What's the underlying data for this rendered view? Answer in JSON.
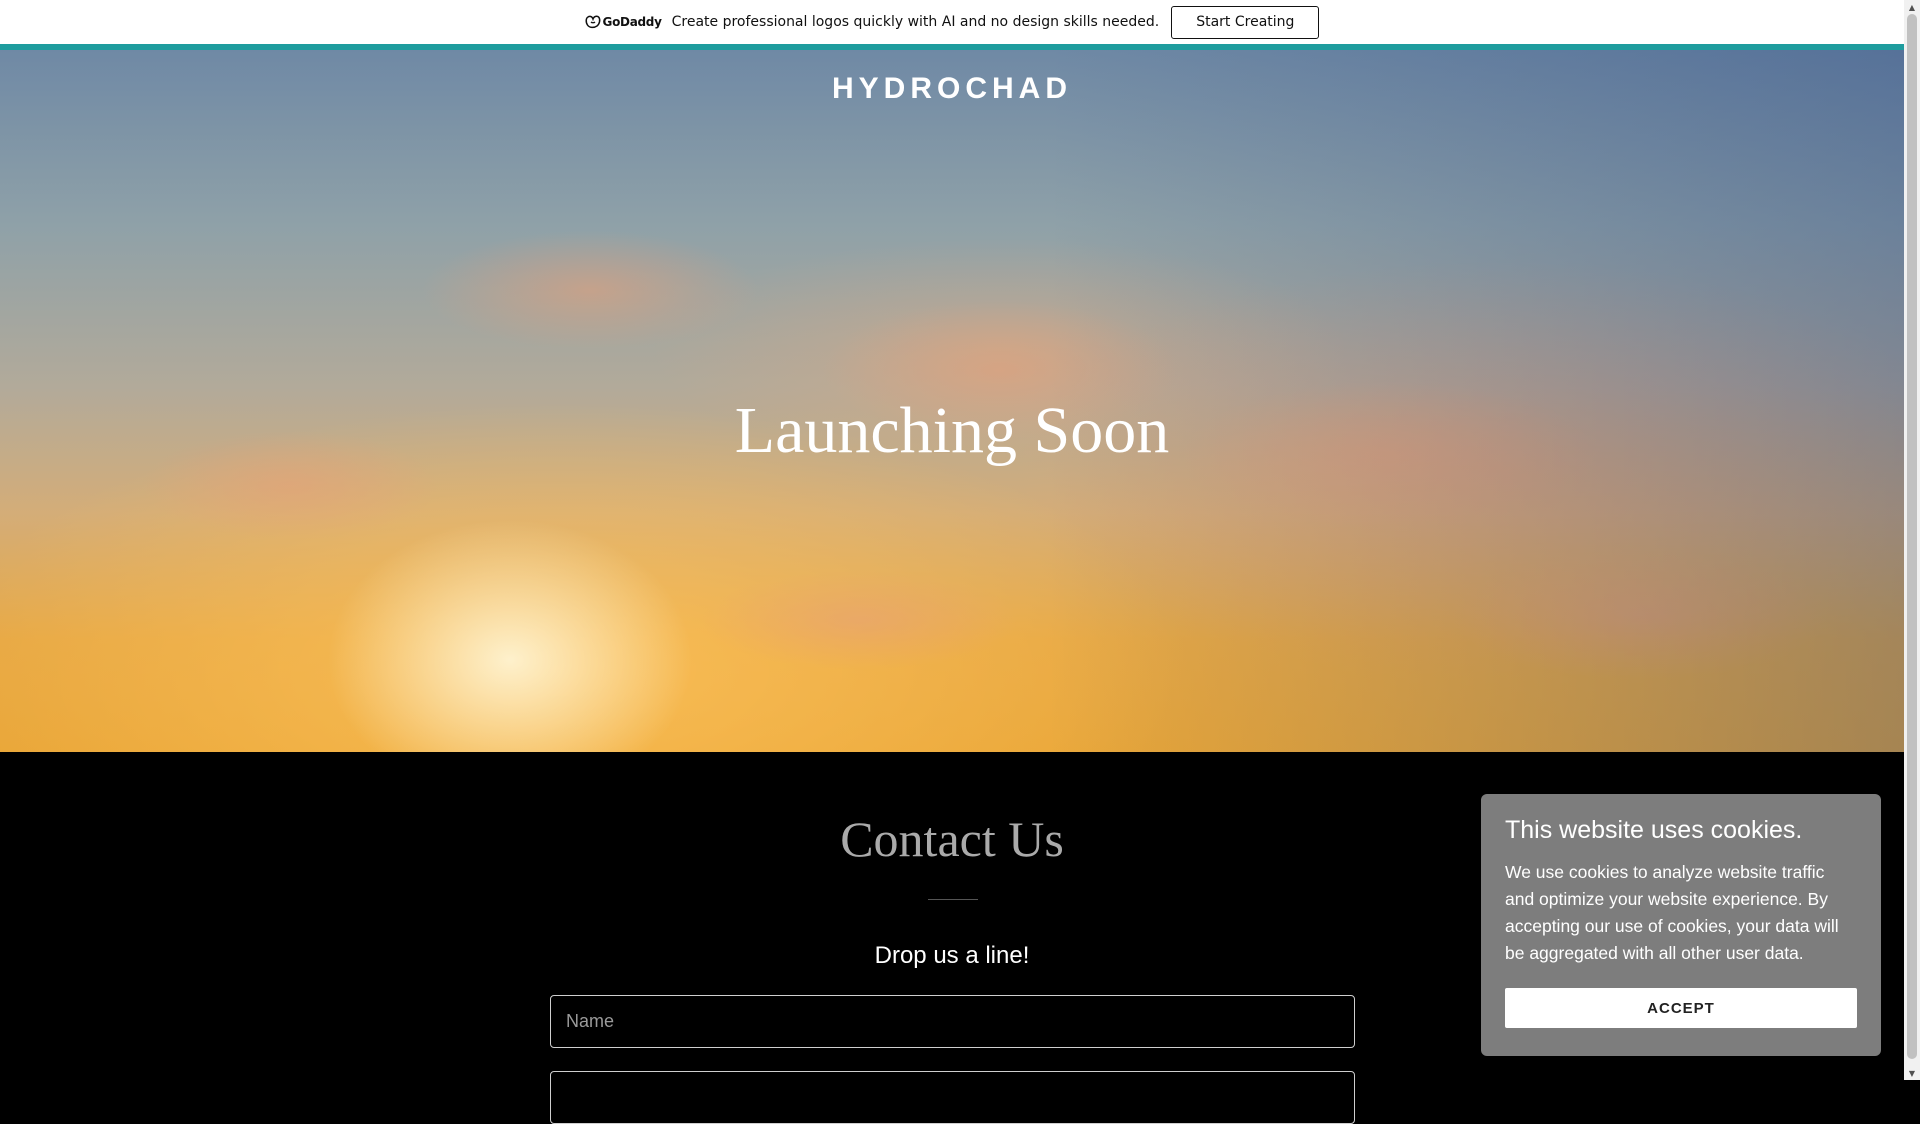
{
  "promo": {
    "brand": "GoDaddy",
    "text": "Create professional logos quickly with AI and no design skills needed.",
    "button_label": "Start Creating",
    "accent_color": "#1e9c9e"
  },
  "hero": {
    "site_name": "HYDROCHAD",
    "title": "Launching Soon"
  },
  "contact": {
    "title": "Contact Us",
    "subtitle": "Drop us a line!",
    "name_placeholder": "Name",
    "next_placeholder": ""
  },
  "cookie": {
    "title": "This website uses cookies.",
    "body": "We use cookies to analyze website traffic and optimize your website experience. By accepting our use of cookies, your data will be aggregated with all other user data.",
    "button_label": "ACCEPT"
  },
  "icons": {
    "brand_logo": "godaddy-logo-icon",
    "scroll_up": "chevron-up-icon",
    "scroll_down": "chevron-down-icon"
  }
}
